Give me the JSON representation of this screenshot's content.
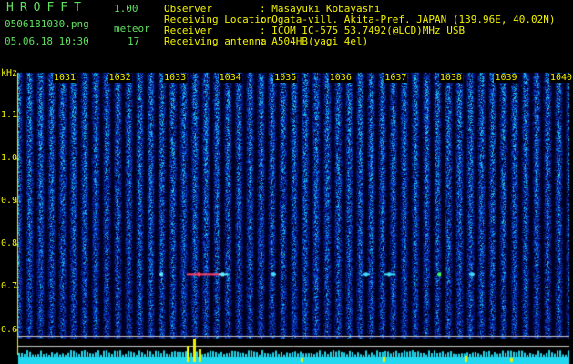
{
  "header": {
    "app": "HROFFT",
    "version": "1.00",
    "filename": "0506181030.png",
    "date": "05.06.18 10:30",
    "meteor_label": "meteor",
    "meteor_count": "17"
  },
  "info": {
    "observer_label": "Observer",
    "observer": ": Masayuki Kobayashi",
    "location_label": "Receiving Location",
    "location": ": Ogata-vill. Akita-Pref. JAPAN (139.96E, 40.02N)",
    "receiver_label": "Receiver",
    "receiver": ": ICOM IC-575 53.7492(@LCD)MHz USB",
    "antenna_label": "Receiving antenna",
    "antenna": ": A504HB(yagi 4el)"
  },
  "colors": {
    "label_green": "#5fe05f",
    "axis_yellow": "#f2f200",
    "background": "#000000",
    "noise_dark": "#0a2080",
    "noise_bright": "#19c8f0",
    "level_cyan": "#22d8f0",
    "level_peak": "#f2f200"
  },
  "chart_data": {
    "type": "heatmap",
    "y_axis": {
      "unit": "kHz",
      "ticks": [
        "1.1",
        "1.0",
        "0.9",
        "0.8",
        "0.7",
        "0.6"
      ],
      "range": [
        0.58,
        1.2
      ]
    },
    "x_axis": {
      "ticks": [
        "1031",
        "1032",
        "1033",
        "1034",
        "1035",
        "1036",
        "1037",
        "1038",
        "1039",
        "1040"
      ]
    },
    "meteor_echo_band_khz": 0.73,
    "meteor_count": 17
  }
}
